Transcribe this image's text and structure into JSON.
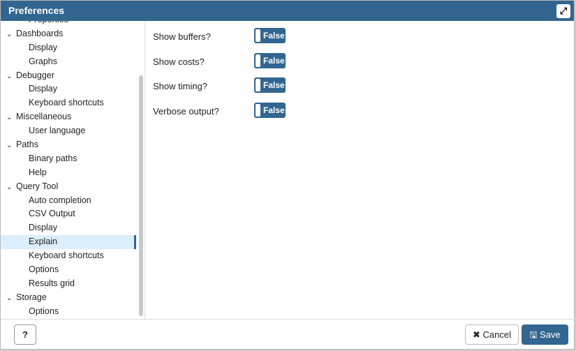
{
  "title": "Preferences",
  "sidebar": [
    {
      "label": "Properties",
      "type": "leaf"
    },
    {
      "label": "Dashboards",
      "type": "group"
    },
    {
      "label": "Display",
      "type": "leaf"
    },
    {
      "label": "Graphs",
      "type": "leaf"
    },
    {
      "label": "Debugger",
      "type": "group"
    },
    {
      "label": "Display",
      "type": "leaf"
    },
    {
      "label": "Keyboard shortcuts",
      "type": "leaf"
    },
    {
      "label": "Miscellaneous",
      "type": "group"
    },
    {
      "label": "User language",
      "type": "leaf"
    },
    {
      "label": "Paths",
      "type": "group"
    },
    {
      "label": "Binary paths",
      "type": "leaf"
    },
    {
      "label": "Help",
      "type": "leaf"
    },
    {
      "label": "Query Tool",
      "type": "group"
    },
    {
      "label": "Auto completion",
      "type": "leaf"
    },
    {
      "label": "CSV Output",
      "type": "leaf"
    },
    {
      "label": "Display",
      "type": "leaf"
    },
    {
      "label": "Explain",
      "type": "leaf",
      "selected": true
    },
    {
      "label": "Keyboard shortcuts",
      "type": "leaf"
    },
    {
      "label": "Options",
      "type": "leaf"
    },
    {
      "label": "Results grid",
      "type": "leaf"
    },
    {
      "label": "Storage",
      "type": "group"
    },
    {
      "label": "Options",
      "type": "leaf"
    }
  ],
  "settings": [
    {
      "label": "Show buffers?",
      "value": "False"
    },
    {
      "label": "Show costs?",
      "value": "False"
    },
    {
      "label": "Show timing?",
      "value": "False"
    },
    {
      "label": "Verbose output?",
      "value": "False"
    }
  ],
  "footer": {
    "help": "?",
    "cancel": "Cancel",
    "save": "Save"
  },
  "colors": {
    "accent": "#326690",
    "selected": "#dbeefb"
  }
}
